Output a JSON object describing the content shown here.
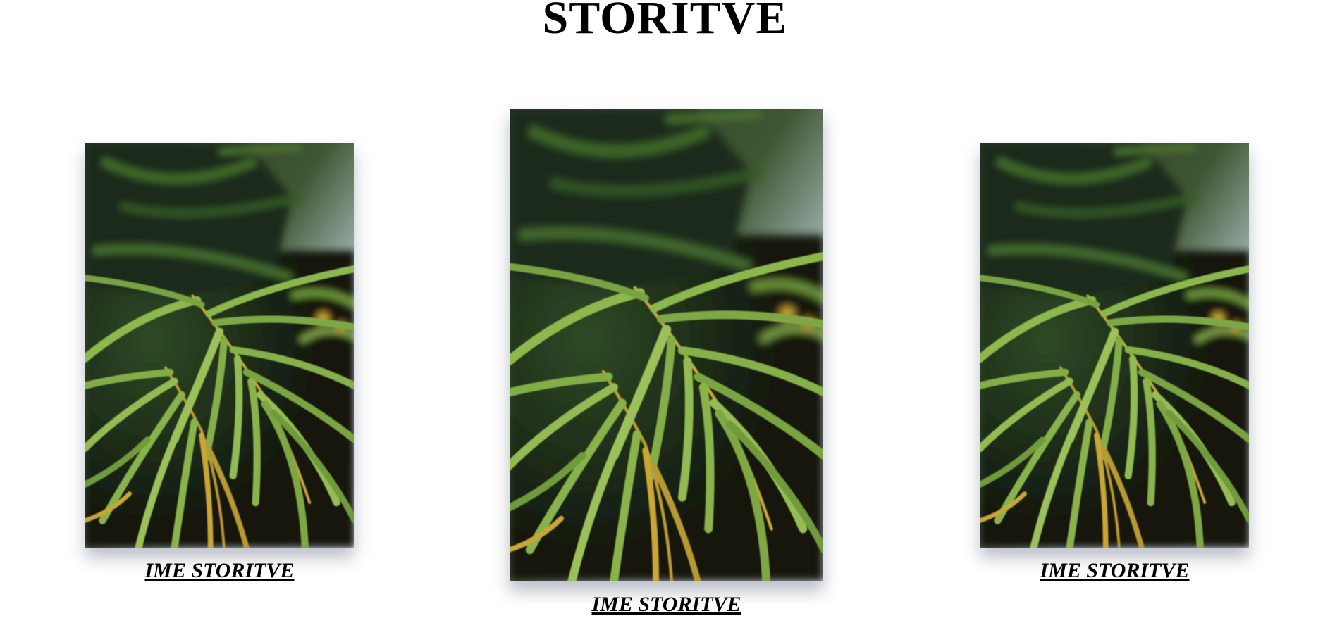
{
  "header": {
    "title": "STORITVE"
  },
  "services": [
    {
      "label": "IME STORITVE",
      "image": "palm-leaves-photo"
    },
    {
      "label": "IME STORITVE",
      "image": "palm-leaves-photo"
    },
    {
      "label": "IME STORITVE",
      "image": "palm-leaves-photo"
    }
  ],
  "colors": {
    "sky": "#c9d6dc",
    "dark_foliage": "#1e2a1c",
    "leaf_green": "#6f9a3a",
    "leaf_light": "#9cc15a",
    "leaf_yellow": "#c9a634"
  }
}
